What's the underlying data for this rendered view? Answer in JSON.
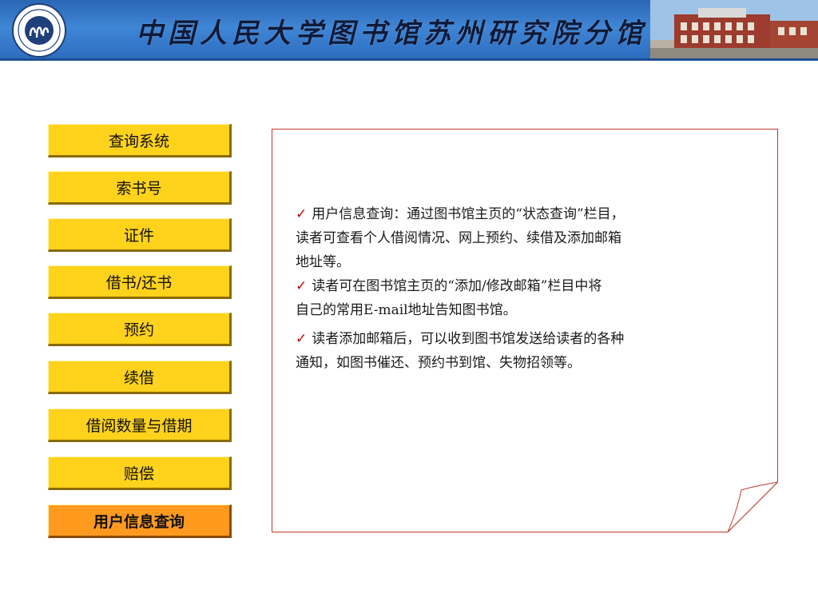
{
  "header": {
    "title": "中国人民大学图书馆苏州研究院分馆",
    "logo_icon": "university-seal-icon",
    "building_image": "library-building-photo"
  },
  "menu": {
    "items": [
      {
        "label": "查询系统",
        "active": false
      },
      {
        "label": "索书号",
        "active": false
      },
      {
        "label": "证件",
        "active": false
      },
      {
        "label": "借书/还书",
        "active": false
      },
      {
        "label": "预约",
        "active": false
      },
      {
        "label": "续借",
        "active": false
      },
      {
        "label": "借阅数量与借期",
        "active": false
      },
      {
        "label": "赔偿",
        "active": false
      },
      {
        "label": "用户信息查询",
        "active": true
      }
    ]
  },
  "content": {
    "bullet_icon": "checkmark-icon",
    "paragraphs": [
      {
        "check": "✓",
        "lines": [
          "用户信息查询：通过图书馆主页的“状态查询”栏目，",
          "读者可查看个人借阅情况、网上预约、续借及添加邮箱",
          "地址等。"
        ]
      },
      {
        "check": "✓",
        "lines": [
          "读者可在图书馆主页的“添加/修改邮箱”栏目中将",
          "自己的常用E-mail地址告知图书馆。"
        ]
      },
      {
        "check": "✓",
        "lines": [
          "读者添加邮箱后，可以收到图书馆发送给读者的各种",
          "通知，如图书催还、预约书到馆、失物招领等。"
        ]
      }
    ]
  },
  "colors": {
    "menu_button": "#ffd21c",
    "menu_button_active": "#ff9a1f",
    "card_border": "#c0392b",
    "banner": "#3f86d6"
  }
}
